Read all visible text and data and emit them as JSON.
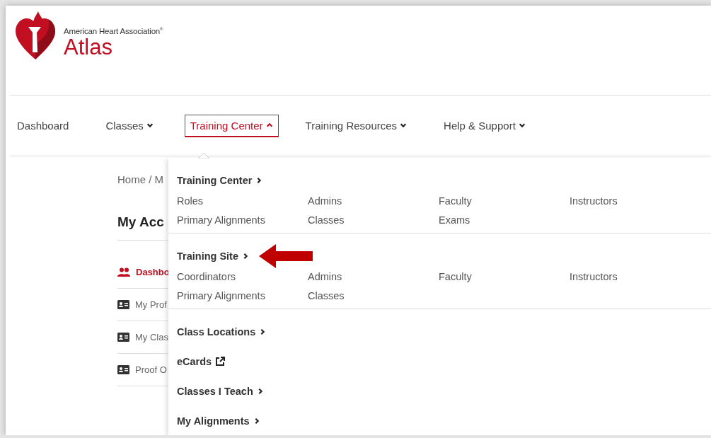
{
  "logo": {
    "org": "American Heart Association",
    "org_mark": "®",
    "product": "Atlas"
  },
  "nav": [
    {
      "kind": "link",
      "label": "Dashboard",
      "selected": false
    },
    {
      "kind": "menu",
      "label": "Classes",
      "selected": false
    },
    {
      "kind": "open_menu",
      "label": "Training Center",
      "selected": true
    },
    {
      "kind": "menu",
      "label": "Training Resources",
      "selected": false
    },
    {
      "kind": "menu",
      "label": "Help & Support",
      "selected": false
    }
  ],
  "breadcrumb": "Home / M",
  "page_title": "My Acc",
  "sidebar": {
    "items": [
      {
        "label": "Dashbo",
        "selected": true
      },
      {
        "label": "My Prof",
        "selected": false
      },
      {
        "label": "My Clas",
        "selected": false
      },
      {
        "label": "Proof O",
        "selected": false
      }
    ]
  },
  "dropdown": {
    "sections": [
      {
        "kind": "group",
        "title": "Training Center",
        "callout": false,
        "links": [
          "Roles",
          "Admins",
          "Faculty",
          "Instructors",
          "Primary Alignments",
          "Classes",
          "Exams"
        ]
      },
      {
        "kind": "group",
        "title": "Training Site",
        "callout": true,
        "links": [
          "Coordinators",
          "Admins",
          "Faculty",
          "Instructors",
          "Primary Alignments",
          "Classes"
        ]
      },
      {
        "kind": "link",
        "title": "Class Locations",
        "callout": false
      },
      {
        "kind": "external",
        "title": "eCards",
        "callout": false
      },
      {
        "kind": "link",
        "title": "Classes I Teach",
        "callout": false
      },
      {
        "kind": "link",
        "title": "My Alignments",
        "callout": false
      }
    ]
  }
}
